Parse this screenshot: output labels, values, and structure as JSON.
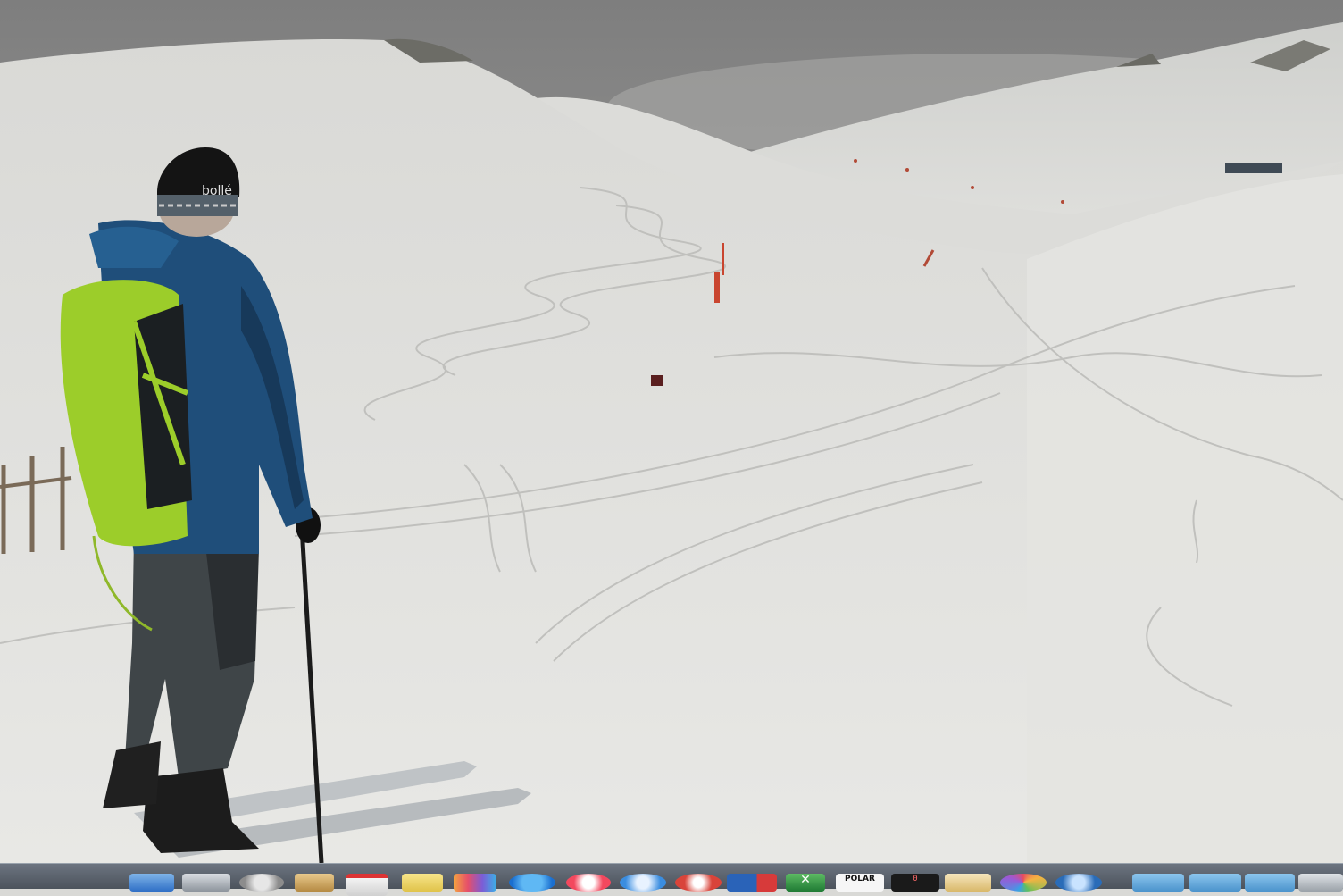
{
  "desktop": {
    "wallpaper_icon": "snow-mountain-skier-photo",
    "colors": {
      "snow": "#e3e3e0",
      "sky": "#8f8f8f",
      "jacket": "#1f4e7a",
      "backpack": "#9ccd2a",
      "pole_marker": "#c9452f"
    }
  },
  "dock": {
    "items": [
      {
        "icon": "finder-icon",
        "label": ""
      },
      {
        "icon": "system-preferences-icon",
        "label": ""
      },
      {
        "icon": "disk-utility-icon",
        "label": ""
      },
      {
        "icon": "contacts-icon",
        "label": ""
      },
      {
        "icon": "calendar-icon",
        "label": ""
      },
      {
        "icon": "notes-icon",
        "label": ""
      },
      {
        "icon": "photos-icon",
        "label": ""
      },
      {
        "icon": "app-store-icon",
        "label": ""
      },
      {
        "icon": "itunes-icon",
        "label": ""
      },
      {
        "icon": "safari-icon",
        "label": ""
      },
      {
        "icon": "chrome-icon",
        "label": ""
      },
      {
        "icon": "parallels-icon",
        "label": ""
      },
      {
        "icon": "excel-icon",
        "label": ""
      },
      {
        "icon": "polar-flowsync-icon",
        "label": "POLAR"
      },
      {
        "icon": "terminal-icon",
        "label": "0"
      },
      {
        "icon": "preview-icon",
        "label": ""
      },
      {
        "icon": "color-picker-icon",
        "label": ""
      },
      {
        "icon": "quicktime-icon",
        "label": ""
      },
      {
        "icon": "folder-icon",
        "label": ""
      },
      {
        "icon": "folder-icon",
        "label": ""
      },
      {
        "icon": "folder-icon",
        "label": ""
      },
      {
        "icon": "trash-icon",
        "label": ""
      }
    ]
  }
}
